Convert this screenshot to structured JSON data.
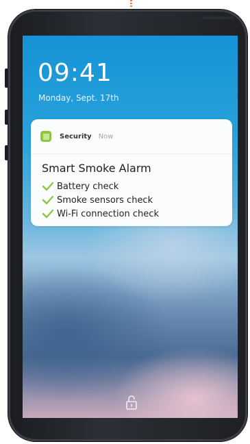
{
  "lockscreen": {
    "time": "09:41",
    "date": "Monday, Sept. 17th"
  },
  "notification": {
    "app_name": "Security",
    "timestamp": "Now",
    "title": "Smart Smoke Alarm",
    "items": [
      {
        "label": "Battery check",
        "icon": "check-icon"
      },
      {
        "label": "Smoke sensors check",
        "icon": "check-icon"
      },
      {
        "label": "Wi-Fi connection check",
        "icon": "check-icon"
      }
    ],
    "accent_color": "#8cc63f"
  },
  "icons": {
    "app": "security-app-icon",
    "unlock": "lock-icon"
  }
}
